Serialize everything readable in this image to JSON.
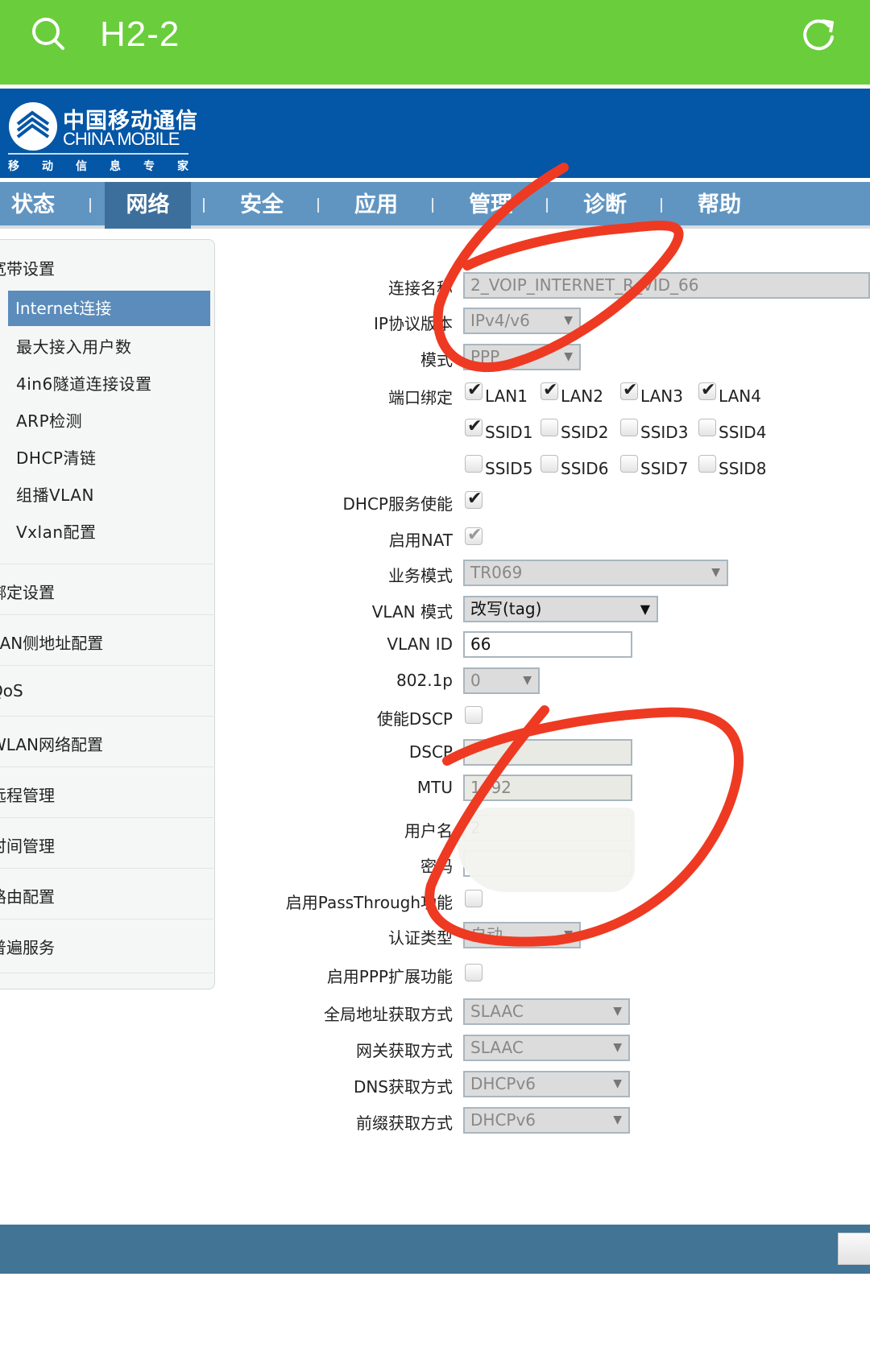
{
  "topbar": {
    "title": "H2-2",
    "search_icon": "search-icon",
    "refresh_icon": "refresh-icon",
    "color": "#6acd3c"
  },
  "banner": {
    "logo_cn": "中国移动通信",
    "logo_en": "CHINA MOBILE",
    "slogan": [
      "移",
      "动",
      "信",
      "息",
      "专",
      "家"
    ],
    "color": "#0456a6"
  },
  "nav": {
    "items": [
      {
        "label": "状态"
      },
      {
        "label": "网络",
        "active": true
      },
      {
        "label": "安全"
      },
      {
        "label": "应用"
      },
      {
        "label": "管理"
      },
      {
        "label": "诊断"
      },
      {
        "label": "帮助"
      }
    ]
  },
  "sidebar": {
    "group": "宽带设置",
    "active": "Internet连接",
    "subitems": [
      "最大接入用户数",
      "4in6隧道连接设置",
      "ARP检测",
      "DHCP清链",
      "组播VLAN",
      "Vxlan配置"
    ],
    "sections": [
      "绑定设置",
      "LAN侧地址配置",
      "QoS",
      "WLAN网络配置",
      "远程管理",
      "时间管理",
      "路由配置",
      "普遍服务"
    ]
  },
  "form": {
    "conn_name": {
      "label": "连接名称",
      "value": "2_VOIP_INTERNET_R_VID_66"
    },
    "ip_version": {
      "label": "IP协议版本",
      "value": "IPv4/v6"
    },
    "mode": {
      "label": "模式",
      "value": "PPP"
    },
    "port_binding": {
      "label": "端口绑定",
      "options": [
        {
          "label": "LAN1",
          "checked": true
        },
        {
          "label": "LAN2",
          "checked": true
        },
        {
          "label": "LAN3",
          "checked": true
        },
        {
          "label": "LAN4",
          "checked": true
        },
        {
          "label": "SSID1",
          "checked": true
        },
        {
          "label": "SSID2",
          "checked": false
        },
        {
          "label": "SSID3",
          "checked": false
        },
        {
          "label": "SSID4",
          "checked": false
        },
        {
          "label": "SSID5",
          "checked": false
        },
        {
          "label": "SSID6",
          "checked": false
        },
        {
          "label": "SSID7",
          "checked": false
        },
        {
          "label": "SSID8",
          "checked": false
        }
      ]
    },
    "dhcp_enable": {
      "label": "DHCP服务使能",
      "checked": true
    },
    "nat_enable": {
      "label": "启用NAT",
      "checked": true,
      "disabled": true
    },
    "service_mode": {
      "label": "业务模式",
      "value": "TR069"
    },
    "vlan_mode": {
      "label": "VLAN 模式",
      "value": "改写(tag)"
    },
    "vlan_id": {
      "label": "VLAN ID",
      "value": "66"
    },
    "p8021p": {
      "label": "802.1p",
      "value": "0"
    },
    "dscp_enable": {
      "label": "使能DSCP",
      "checked": false
    },
    "dscp": {
      "label": "DSCP",
      "value": ""
    },
    "mtu": {
      "label": "MTU",
      "value": "1492"
    },
    "username": {
      "label": "用户名",
      "value": "2"
    },
    "password": {
      "label": "密码",
      "value": ""
    },
    "passthrough": {
      "label": "启用PassThrough功能",
      "checked": false
    },
    "auth_type": {
      "label": "认证类型",
      "value": "自动"
    },
    "ppp_ext": {
      "label": "启用PPP扩展功能",
      "checked": false
    },
    "global_addr": {
      "label": "全局地址获取方式",
      "value": "SLAAC"
    },
    "gateway": {
      "label": "网关获取方式",
      "value": "SLAAC"
    },
    "dns": {
      "label": "DNS获取方式",
      "value": "DHCPv6"
    },
    "prefix": {
      "label": "前缀获取方式",
      "value": "DHCPv6"
    }
  },
  "annotation_color": "#ee3a22"
}
